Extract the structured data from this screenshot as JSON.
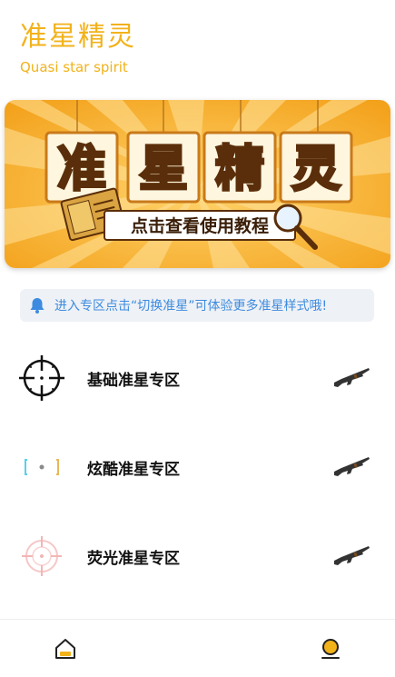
{
  "header": {
    "title": "准星精灵",
    "subtitle": "Quasi star spirit"
  },
  "banner": {
    "title_chars": [
      "准",
      "星",
      "精",
      "灵"
    ],
    "cta": "点击查看使用教程"
  },
  "notice": {
    "icon": "bell-icon",
    "text": "进入专区点击“切换准星”可体验更多准星样式哦!"
  },
  "zones": [
    {
      "label": "基础准星专区",
      "icon": "crosshair-basic-icon",
      "action_icon": "rifle-icon"
    },
    {
      "label": "炫酷准星专区",
      "icon": "crosshair-cool-icon",
      "action_icon": "rifle-icon"
    },
    {
      "label": "荧光准星专区",
      "icon": "crosshair-glow-icon",
      "action_icon": "rifle-icon"
    }
  ],
  "tabbar": {
    "tabs": [
      {
        "icon": "home-icon"
      },
      {
        "icon": "profile-icon"
      }
    ]
  },
  "colors": {
    "brand": "#f2b21a",
    "notice_text": "#3d8be0",
    "banner_bg": "#f5a623"
  }
}
